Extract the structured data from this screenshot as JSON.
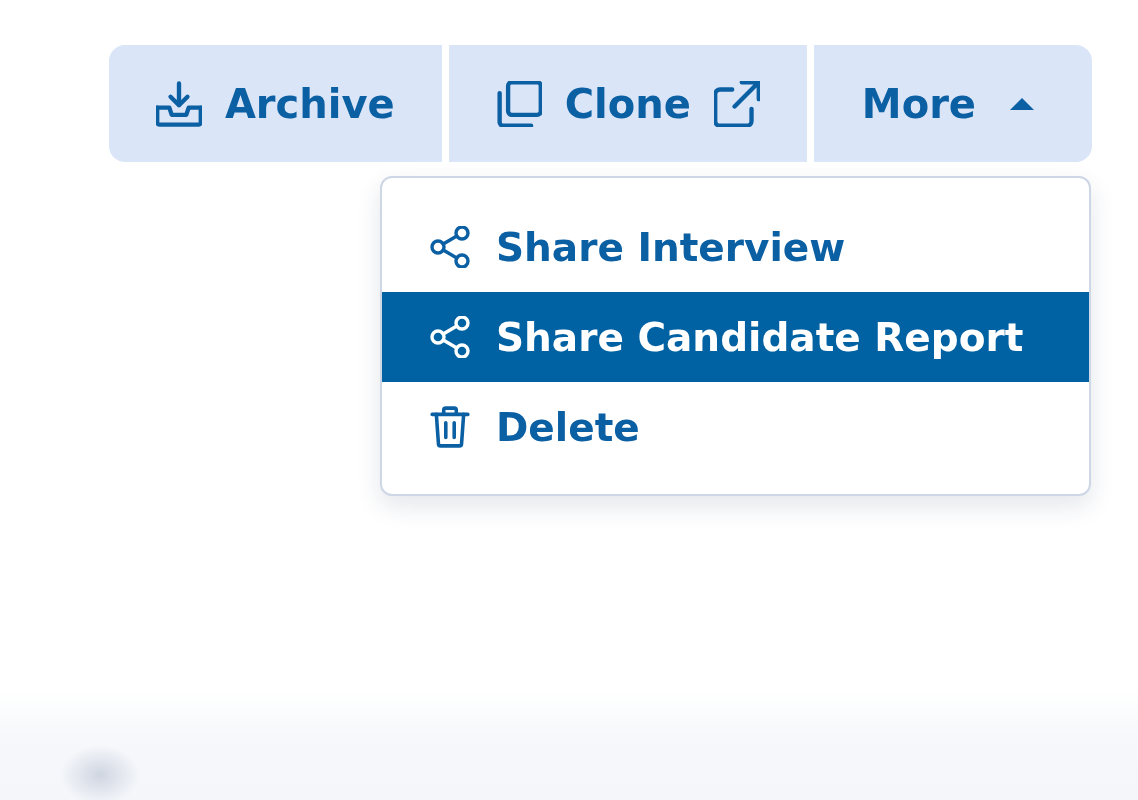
{
  "actions": [
    {
      "label": "Archive",
      "kind": "archive"
    },
    {
      "label": "Clone",
      "kind": "clone"
    },
    {
      "label": "More",
      "kind": "more",
      "expanded": true
    }
  ],
  "menu": {
    "items": [
      {
        "label": "Share Interview",
        "kind": "share",
        "selected": false
      },
      {
        "label": "Share Candidate Report",
        "kind": "share",
        "selected": true
      },
      {
        "label": "Delete",
        "kind": "delete",
        "selected": false
      }
    ]
  }
}
